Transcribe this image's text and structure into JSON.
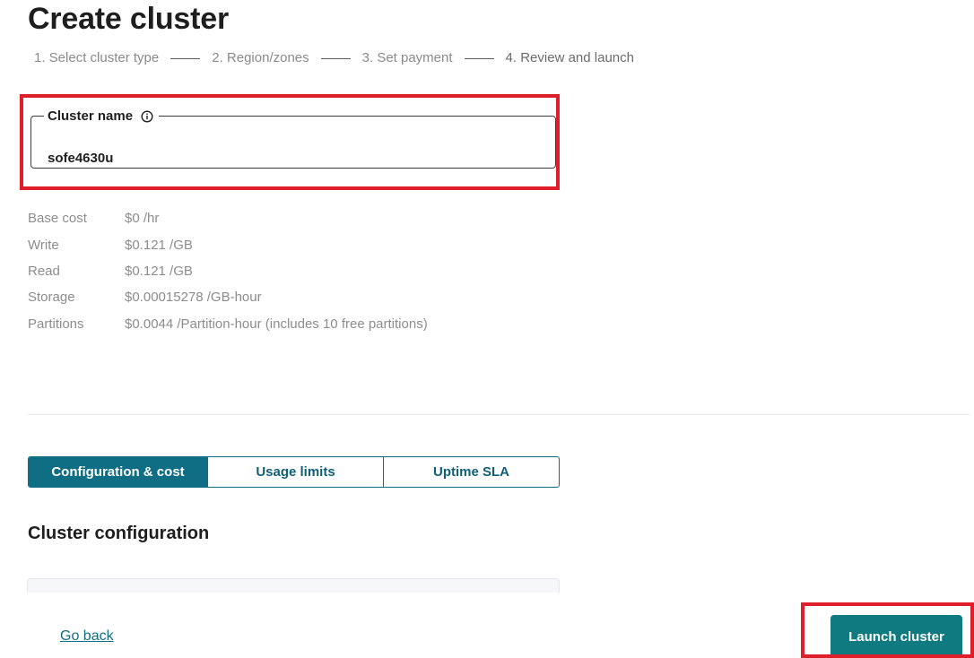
{
  "page": {
    "title": "Create cluster"
  },
  "stepper": {
    "steps": [
      "1. Select cluster type",
      "2. Region/zones",
      "3. Set payment",
      "4. Review and launch"
    ]
  },
  "cluster_name": {
    "label": "Cluster name",
    "value": "sofe4630u"
  },
  "costs": [
    {
      "label": "Base cost",
      "value": "$0 /hr"
    },
    {
      "label": "Write",
      "value": "$0.121 /GB"
    },
    {
      "label": "Read",
      "value": "$0.121 /GB"
    },
    {
      "label": "Storage",
      "value": "$0.00015278 /GB-hour"
    },
    {
      "label": "Partitions",
      "value": "$0.0044 /Partition-hour (includes 10 free partitions)"
    }
  ],
  "tabs": [
    {
      "label": "Configuration & cost",
      "active": true
    },
    {
      "label": "Usage limits",
      "active": false
    },
    {
      "label": "Uptime SLA",
      "active": false
    }
  ],
  "section": {
    "heading": "Cluster configuration"
  },
  "footer": {
    "go_back": "Go back",
    "launch": "Launch cluster"
  },
  "colors": {
    "primary": "#0f6e84",
    "launch_button": "#0f7a80",
    "highlight": "#e01e2b",
    "muted_text": "#8c8c8c"
  },
  "icons": {
    "cluster_name_info": "info-circle-icon"
  }
}
